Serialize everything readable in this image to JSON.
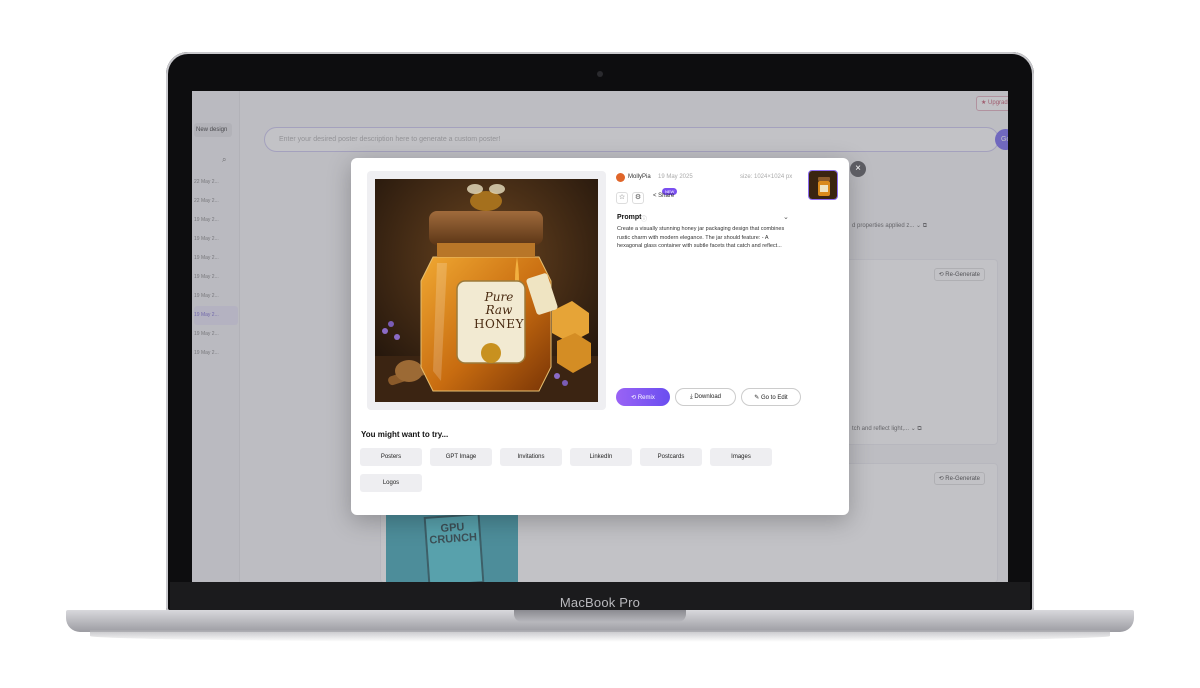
{
  "device": {
    "brand_label": "MacBook Pro"
  },
  "app": {
    "sidebar": {
      "new_design_label": "New design",
      "search_icon": "search-icon",
      "history": [
        "22 May 2...",
        "22 May 2...",
        "19 May 2...",
        "19 May 2...",
        "19 May 2...",
        "19 May 2...",
        "19 May 2...",
        "19 May 2...",
        "19 May 2...",
        "19 May 2..."
      ],
      "active_index": 7
    },
    "header": {
      "upgrade_label": "★ Upgrade"
    },
    "prompt_bar": {
      "placeholder": "Enter your desired poster description here to generate a custom poster!",
      "go_label": "Go"
    },
    "cards": [
      {
        "regenerate_label": "⟲ Re-Generate",
        "snippet": "d properties applied z... ⌄ ⧉"
      },
      {
        "regenerate_label": "⟲ Re-Generate",
        "snippet": "tch and reflect light,... ⌄ ⧉"
      }
    ],
    "thumb_text": "GPU CRUNCH"
  },
  "modal": {
    "close_label": "×",
    "author": {
      "name": "MollyPia",
      "date": "19 May 2025",
      "size": "size: 1024×1024 px"
    },
    "actions": {
      "new_badge": "NEW",
      "share_label": "Share"
    },
    "image_label": {
      "line1": "Pure",
      "line2": "Raw",
      "line3": "HONEY"
    },
    "prompt": {
      "title": "Prompt",
      "text": "Create a visually stunning honey jar packaging design that combines rustic charm with modern elegance. The jar should feature: - A hexagonal glass container with subtle facets that catch and reflect..."
    },
    "buttons": {
      "remix": "Remix",
      "download": "Download",
      "edit": "Go to Edit"
    },
    "suggestions": {
      "title": "You might want to try...",
      "chips": [
        "Posters",
        "GPT Image",
        "Invitations",
        "LinkedIn",
        "Postcards",
        "Images",
        "Logos"
      ]
    }
  }
}
